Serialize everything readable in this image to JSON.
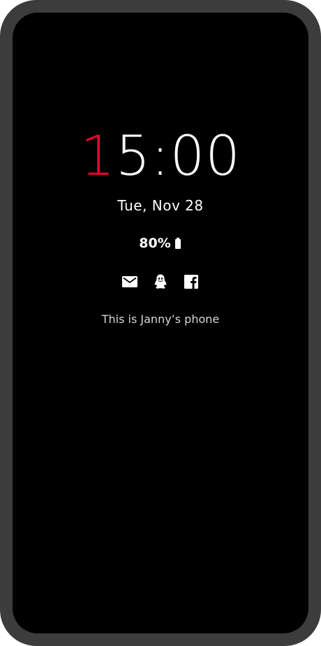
{
  "clock": {
    "accent_digit": "1",
    "rest": "5:00",
    "accent_color": "#e8002d"
  },
  "date": "Tue, Nov 28",
  "battery": {
    "percent_label": "80%",
    "icon": "battery-icon"
  },
  "notifications": [
    {
      "icon": "mail-icon"
    },
    {
      "icon": "qq-icon"
    },
    {
      "icon": "facebook-icon"
    }
  ],
  "owner_message": "This is Janny’s phone",
  "colors": {
    "frame": "#3c3c3c",
    "screen": "#000000",
    "text": "#ffffff"
  }
}
